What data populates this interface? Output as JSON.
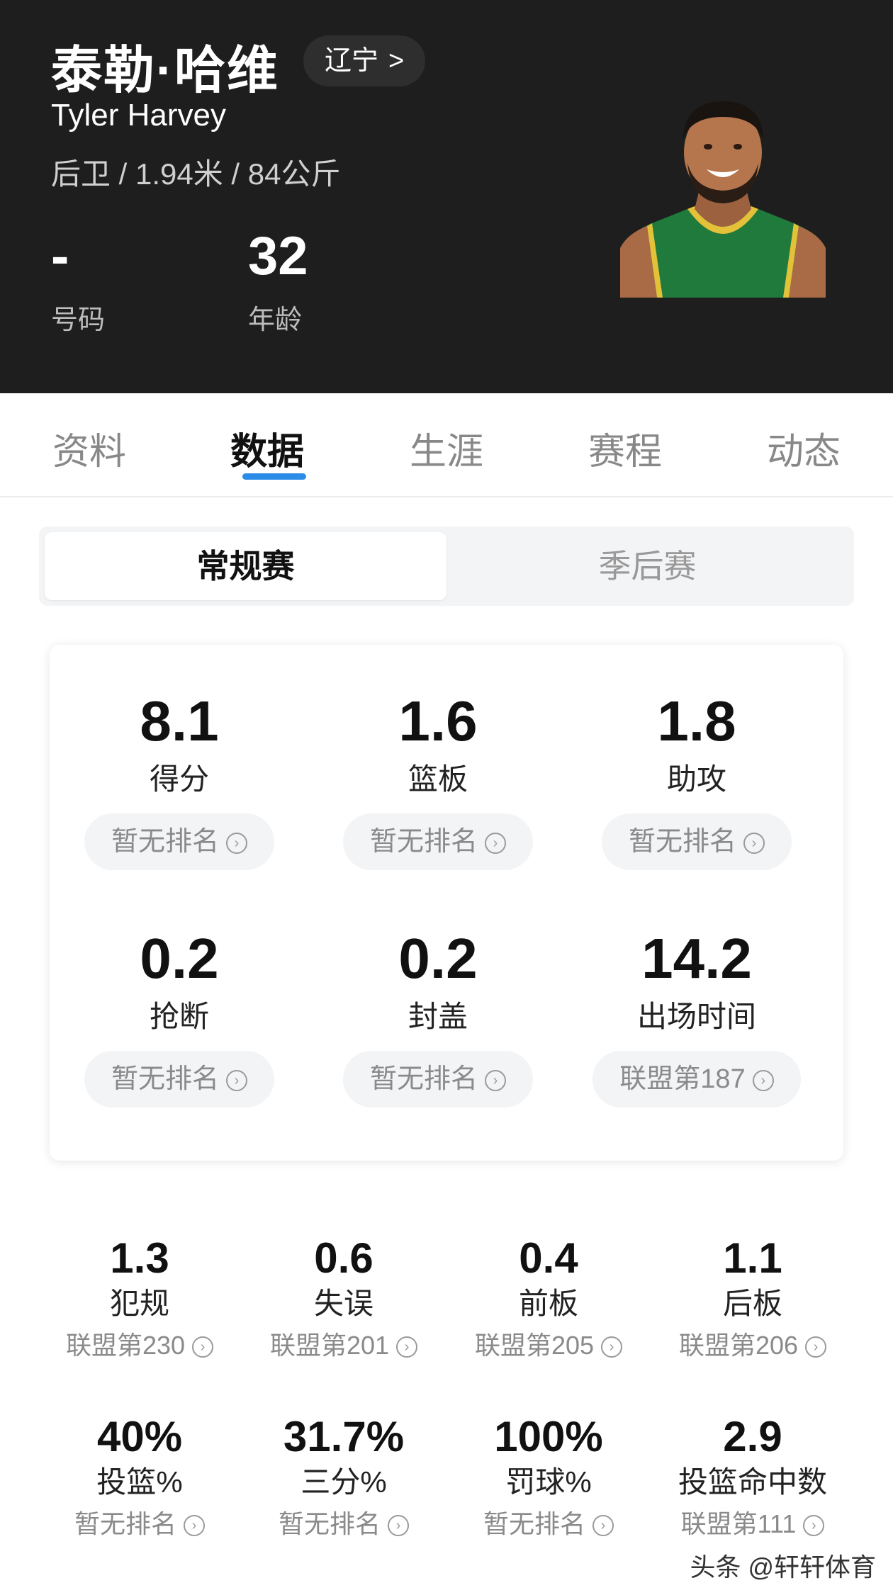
{
  "player": {
    "name_cn": "泰勒·哈维",
    "team": "辽宁",
    "team_chevron": ">",
    "name_en": "Tyler Harvey",
    "bio": "后卫 / 1.94米 / 84公斤",
    "number_value": "-",
    "number_label": "号码",
    "age_value": "32",
    "age_label": "年龄"
  },
  "tabs": [
    "资料",
    "数据",
    "生涯",
    "赛程",
    "动态"
  ],
  "active_tab": "数据",
  "season_toggle": {
    "regular": "常规赛",
    "playoffs": "季后赛"
  },
  "main_stats": [
    {
      "value": "8.1",
      "label": "得分",
      "rank": "暂无排名"
    },
    {
      "value": "1.6",
      "label": "篮板",
      "rank": "暂无排名"
    },
    {
      "value": "1.8",
      "label": "助攻",
      "rank": "暂无排名"
    },
    {
      "value": "0.2",
      "label": "抢断",
      "rank": "暂无排名"
    },
    {
      "value": "0.2",
      "label": "封盖",
      "rank": "暂无排名"
    },
    {
      "value": "14.2",
      "label": "出场时间",
      "rank": "联盟第187"
    }
  ],
  "secondary_stats": [
    {
      "value": "1.3",
      "label": "犯规",
      "rank": "联盟第230"
    },
    {
      "value": "0.6",
      "label": "失误",
      "rank": "联盟第201"
    },
    {
      "value": "0.4",
      "label": "前板",
      "rank": "联盟第205"
    },
    {
      "value": "1.1",
      "label": "后板",
      "rank": "联盟第206"
    },
    {
      "value": "40%",
      "label": "投篮%",
      "rank": "暂无排名"
    },
    {
      "value": "31.7%",
      "label": "三分%",
      "rank": "暂无排名"
    },
    {
      "value": "100%",
      "label": "罚球%",
      "rank": "暂无排名"
    },
    {
      "value": "2.9",
      "label": "投篮命中数",
      "rank": "联盟第111"
    }
  ],
  "watermark": "头条 @轩轩体育",
  "colors": {
    "header_bg": "#1e1e1e",
    "accent": "#2b8ce8",
    "jersey": "#1f7a3c",
    "jersey_trim": "#e3c23a"
  }
}
